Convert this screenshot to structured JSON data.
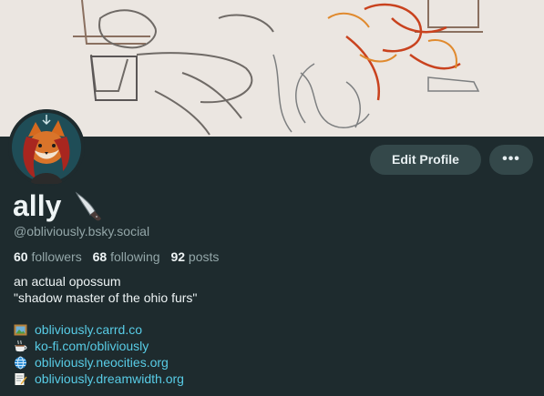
{
  "profile": {
    "display_name": "ally",
    "name_emoji": "kitchen-knife-icon",
    "handle": "@obliviously.bsky.social",
    "stats": {
      "followers_count": "60",
      "followers_label": "followers",
      "following_count": "68",
      "following_label": "following",
      "posts_count": "92",
      "posts_label": "posts"
    },
    "bio_lines": [
      "an actual opossum",
      "\"shadow master of the ohio furs\""
    ],
    "links": [
      {
        "icon": "framed-picture-icon",
        "text": "obliviously.carrd.co"
      },
      {
        "icon": "hot-beverage-icon",
        "text": "ko-fi.com/obliviously"
      },
      {
        "icon": "globe-icon",
        "text": "obliviously.neocities.org"
      },
      {
        "icon": "memo-icon",
        "text": "obliviously.dreamwidth.org"
      }
    ]
  },
  "actions": {
    "edit_label": "Edit Profile",
    "more_label": "•••"
  },
  "colors": {
    "background": "#1e2b2e",
    "button": "#34484a",
    "link": "#58cce6",
    "muted_text": "#93a6a8",
    "text": "#eef4f5"
  }
}
